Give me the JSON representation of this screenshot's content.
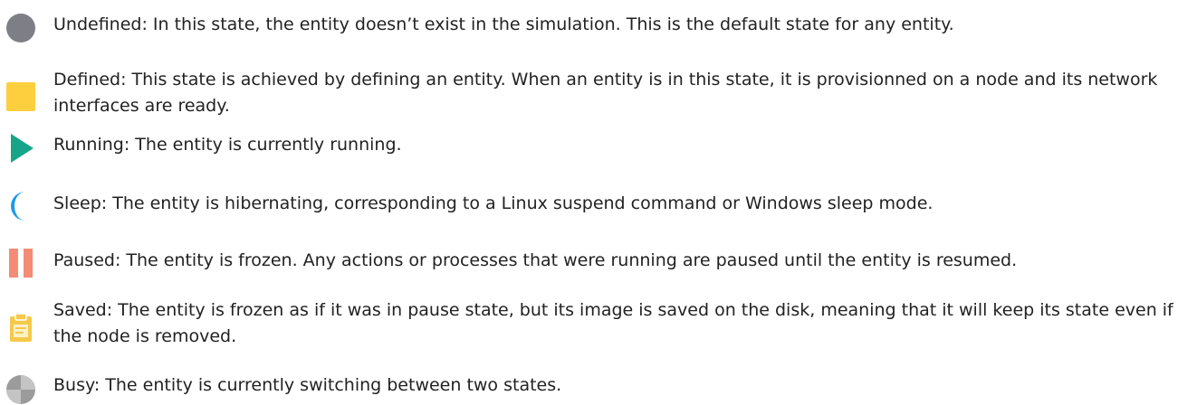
{
  "colors": {
    "text": "#222222",
    "undefined_icon": "#7e7f86",
    "defined_icon": "#fdcf3f",
    "running_icon": "#17a589",
    "sleep_icon": "#1e9be8",
    "paused_icon": "#f48b74",
    "saved_icon": "#f6c94a",
    "busy_icon": "#9b9b9b"
  },
  "states": [
    {
      "name": "Undefined",
      "icon": "grey-circle-icon",
      "text": "Undefined: In this state, the entity doesn’t exist in the simulation. This is the default state for any entity."
    },
    {
      "name": "Defined",
      "icon": "yellow-square-icon",
      "text": "Defined: This state is achieved by defining an entity. When an entity is in this state, it is provisionned on a node and its network interfaces are ready."
    },
    {
      "name": "Running",
      "icon": "play-triangle-icon",
      "text": "Running: The entity is currently running."
    },
    {
      "name": "Sleep",
      "icon": "crescent-moon-icon",
      "text": "Sleep: The entity is hibernating, corresponding to a Linux suspend command or Windows sleep mode."
    },
    {
      "name": "Paused",
      "icon": "pause-bars-icon",
      "text": "Paused: The entity is frozen. Any actions or processes that were running are paused until the entity is resumed."
    },
    {
      "name": "Saved",
      "icon": "clipboard-saved-icon",
      "text": "Saved: The entity is frozen as if it was in pause state, but its image is saved on the disk, meaning that it will keep its state even if the node is removed."
    },
    {
      "name": "Busy",
      "icon": "busy-spinner-icon",
      "text": "Busy: The entity is currently switching between two states."
    }
  ]
}
